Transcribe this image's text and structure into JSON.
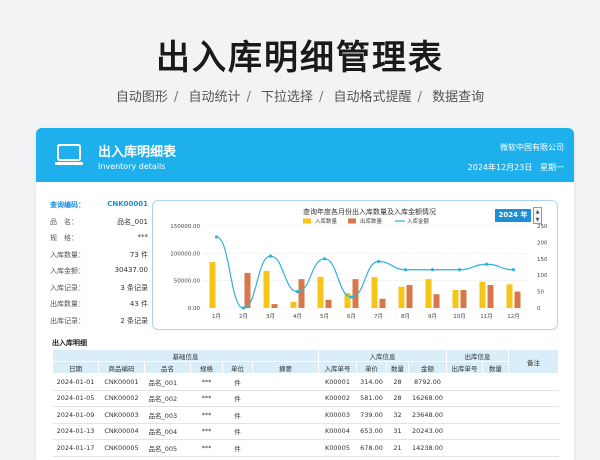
{
  "hero": {
    "title": "出入库明细管理表",
    "features": [
      "自动图形",
      "自动统计",
      "下拉选择",
      "自动格式提醒",
      "数据查询"
    ]
  },
  "header": {
    "title": "出入库明细表",
    "subtitle": "Inventory details",
    "company": "微软中国有限公司",
    "date": "2024年12月23日",
    "weekday": "星期一",
    "color": "#1db0ec"
  },
  "info": [
    {
      "label": "查询编码：",
      "value": "CNK00001"
    },
    {
      "label": "品　名：",
      "value": "品名_001"
    },
    {
      "label": "规　格：",
      "value": "***"
    },
    {
      "label": "入库数量：",
      "value": "73 件"
    },
    {
      "label": "入库金额：",
      "value": "30437.00"
    },
    {
      "label": "入库记录：",
      "value": "3 条记录"
    },
    {
      "label": "出库数量：",
      "value": "43 件"
    },
    {
      "label": "出库记录：",
      "value": "2 条记录"
    }
  ],
  "chart_data": {
    "type": "bar",
    "title": "查询年度各月份出入库数量及入库金额情况",
    "year_label": "2024 年",
    "categories": [
      "1月",
      "2月",
      "3月",
      "4月",
      "5月",
      "6月",
      "7月",
      "8月",
      "9月",
      "10月",
      "11月",
      "12月"
    ],
    "series": [
      {
        "name": "入库数量",
        "type": "bar",
        "axis": "right",
        "color": "#f5c518",
        "values": [
          140,
          0,
          113,
          19,
          95,
          45,
          94,
          65,
          88,
          55,
          80,
          72
        ]
      },
      {
        "name": "出库数量",
        "type": "bar",
        "axis": "right",
        "color": "#d9774a",
        "values": [
          0,
          107,
          12,
          88,
          25,
          88,
          28,
          70,
          42,
          55,
          70,
          50
        ]
      },
      {
        "name": "入库金额",
        "type": "line",
        "axis": "left",
        "color": "#2fb1dc",
        "values": [
          130000,
          0,
          95000,
          30000,
          90000,
          20000,
          85000,
          70000,
          70000,
          70000,
          80000,
          70000
        ]
      }
    ],
    "ylim_left": [
      0,
      150000
    ],
    "yticks_left": [
      "0.00",
      "50000.00",
      "100000.00",
      "150000.00"
    ],
    "ylim_right": [
      0,
      250
    ],
    "yticks_right": [
      "0",
      "50",
      "100",
      "150",
      "200",
      "250"
    ],
    "legend": "top-center"
  },
  "detail": {
    "section_title": "出入库明细",
    "group_headers": {
      "basic": "基础信息",
      "in": "入库信息",
      "out": "出库信息",
      "note": "备注"
    },
    "columns": [
      "日期",
      "商品编码",
      "品名",
      "规格",
      "单位",
      "摘要",
      "入库单号",
      "单价",
      "数量",
      "金额",
      "出库单号",
      "数量"
    ],
    "rows": [
      [
        "2024-01-01",
        "CNK00001",
        "品名_001",
        "***",
        "件",
        "",
        "K00001",
        "314.00",
        "28",
        "8792.00",
        "",
        ""
      ],
      [
        "2024-01-05",
        "CNK00002",
        "品名_002",
        "***",
        "件",
        "",
        "K00002",
        "581.00",
        "28",
        "16268.00",
        "",
        ""
      ],
      [
        "2024-01-09",
        "CNK00003",
        "品名_003",
        "***",
        "件",
        "",
        "K00003",
        "739.00",
        "32",
        "23648.00",
        "",
        ""
      ],
      [
        "2024-01-13",
        "CNK00004",
        "品名_004",
        "***",
        "件",
        "",
        "K00004",
        "653.00",
        "31",
        "20243.00",
        "",
        ""
      ],
      [
        "2024-01-17",
        "CNK00005",
        "品名_005",
        "***",
        "件",
        "",
        "K00005",
        "678.00",
        "21",
        "14238.00",
        "",
        ""
      ]
    ]
  }
}
